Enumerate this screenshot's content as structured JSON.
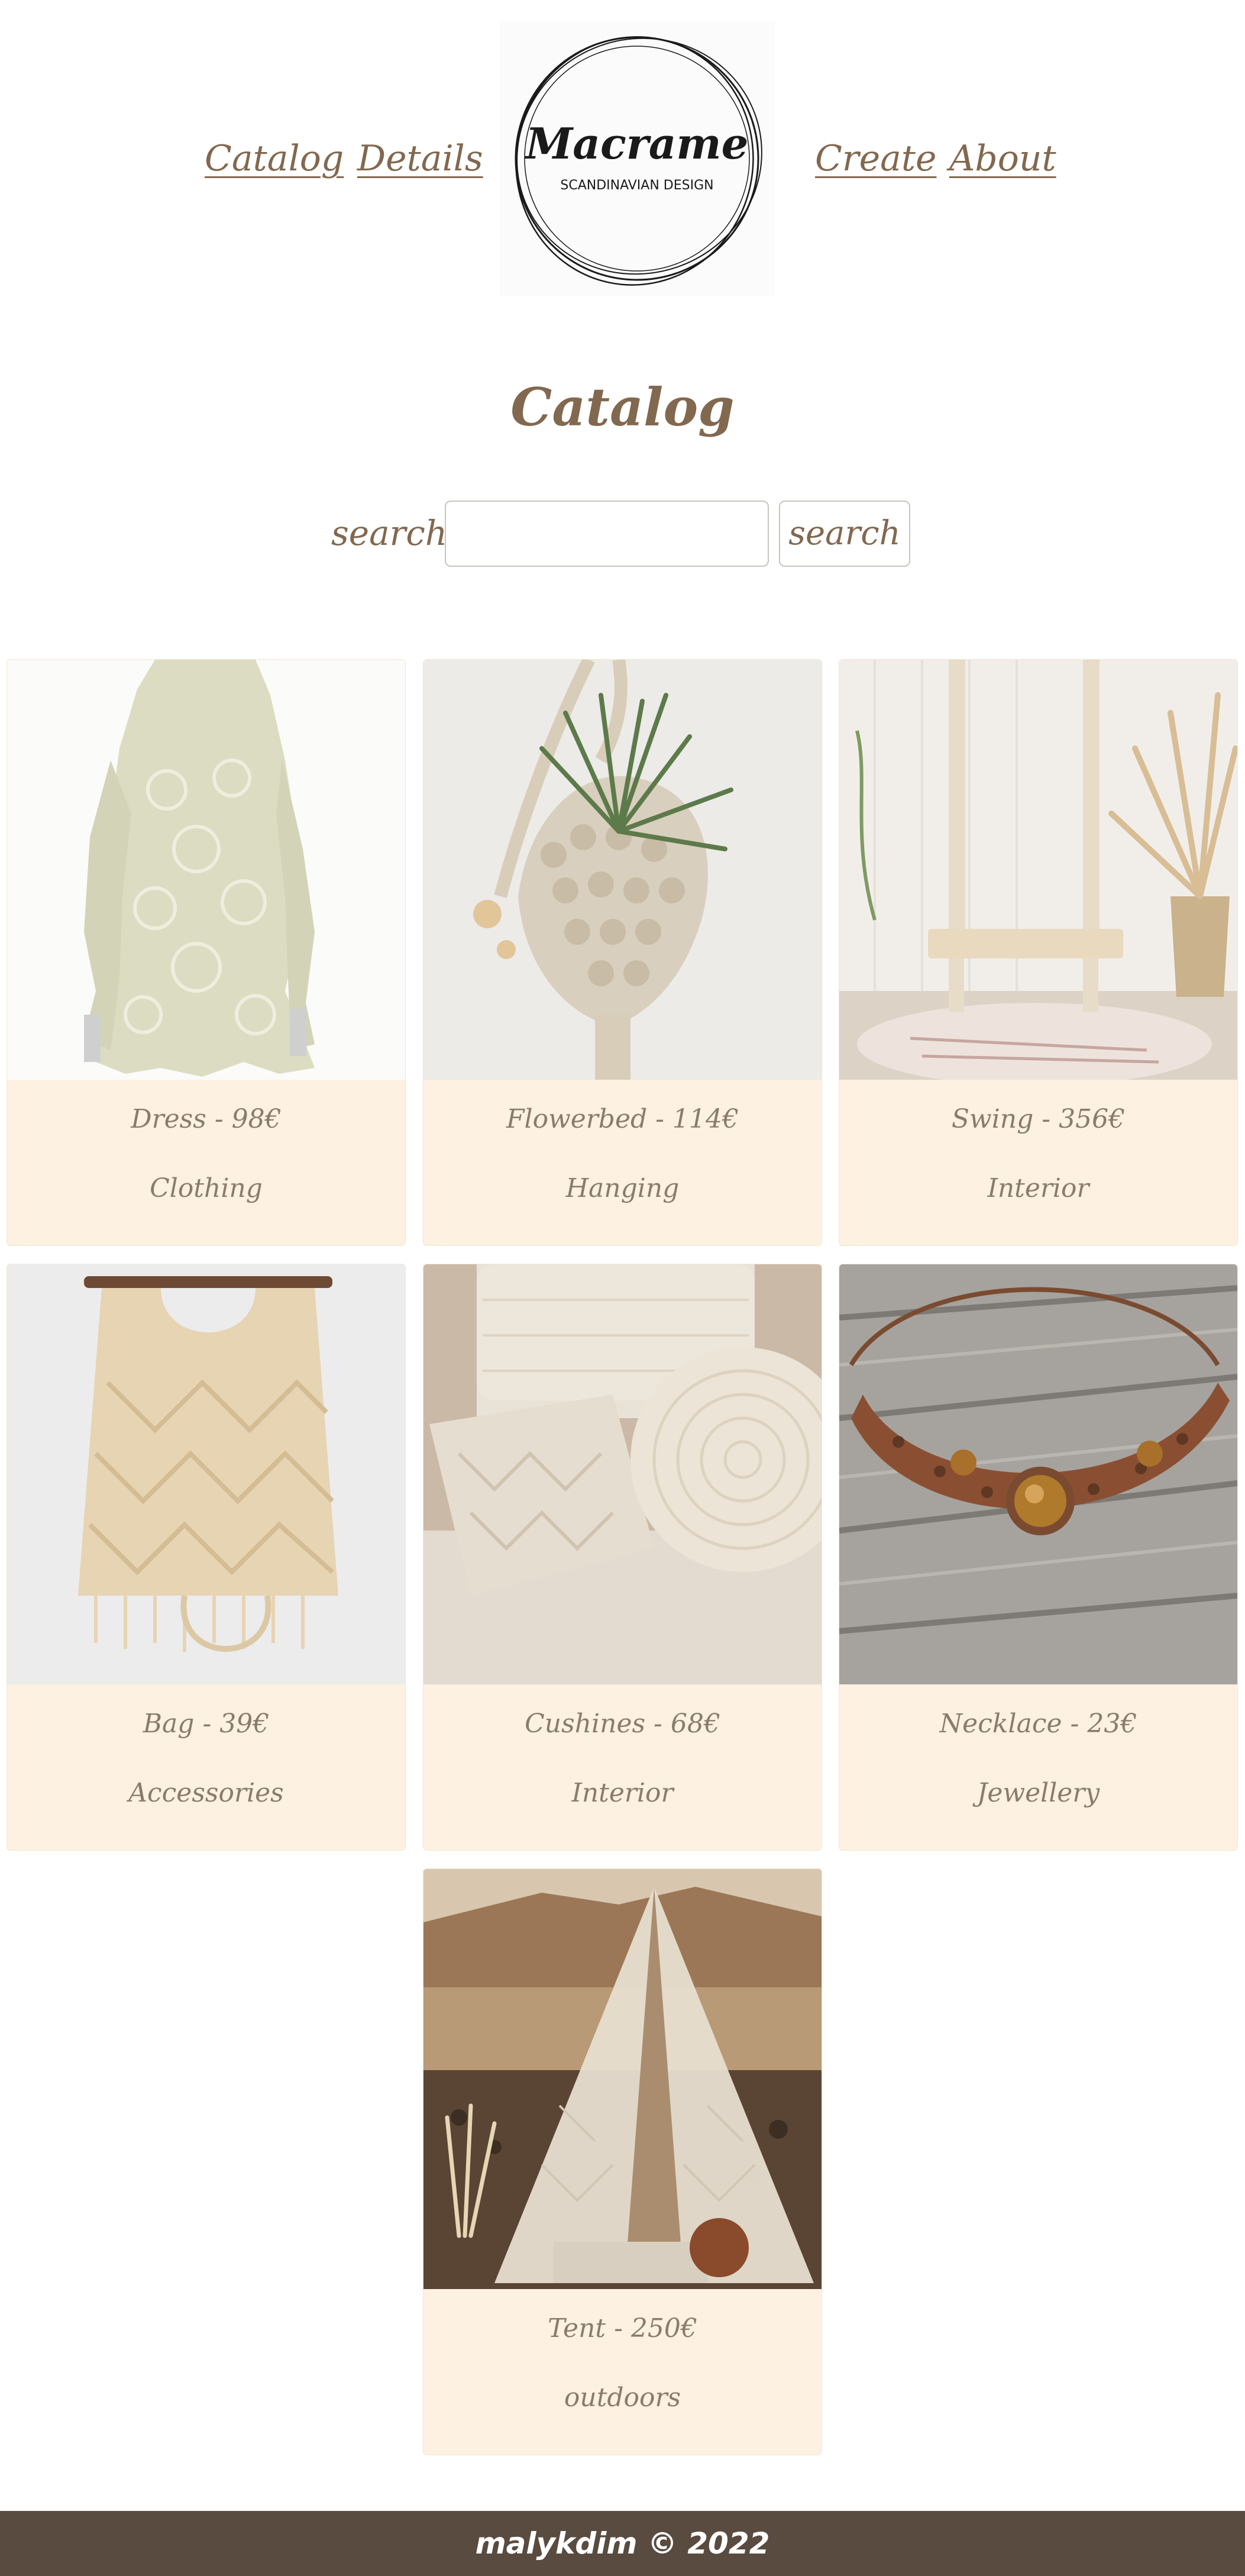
{
  "nav": {
    "links": [
      {
        "label": "Catalog"
      },
      {
        "label": "Details"
      },
      {
        "label": "Create"
      },
      {
        "label": "About"
      }
    ],
    "logo": {
      "name": "Macrame",
      "tagline": "SCANDINAVIAN DESIGN"
    }
  },
  "page": {
    "title": "Catalog"
  },
  "search": {
    "label": "search:",
    "value": "",
    "placeholder": "",
    "button_label": "search"
  },
  "products": [
    {
      "title": "Dress - 98€",
      "category": "Clothing",
      "image": "lace-dress"
    },
    {
      "title": "Flowerbed - 114€",
      "category": "Hanging",
      "image": "hanging-plant-holder"
    },
    {
      "title": "Swing - 356€",
      "category": "Interior",
      "image": "macrame-swing"
    },
    {
      "title": "Bag - 39€",
      "category": "Accessories",
      "image": "macrame-bag"
    },
    {
      "title": "Cushines - 68€",
      "category": "Interior",
      "image": "knitted-cushions"
    },
    {
      "title": "Necklace - 23€",
      "category": "Jewellery",
      "image": "braided-necklace"
    },
    {
      "title": "Tent - 250€",
      "category": "outdoors",
      "image": "macrame-tent"
    }
  ],
  "footer": {
    "text": "malykdim © 2022"
  },
  "colors": {
    "accent": "#82684f",
    "card_background": "#fdf1e1",
    "footer_background": "#594b3f"
  }
}
